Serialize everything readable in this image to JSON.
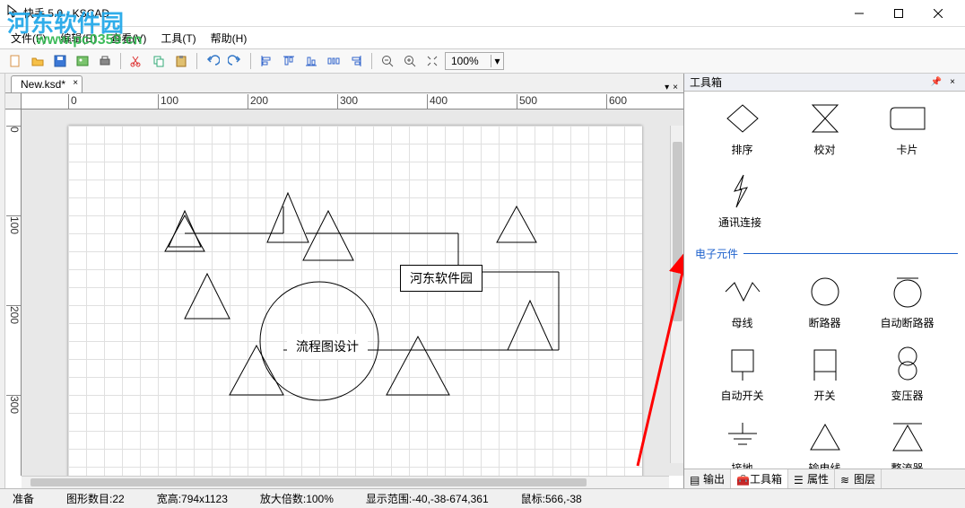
{
  "window": {
    "title": "快手 5.0 - KSCAD"
  },
  "menubar": {
    "file": "文件(F)",
    "edit": "编辑(E)",
    "view": "查看(V)",
    "tool": "工具(T)",
    "help": "帮助(H)"
  },
  "toolbar": {
    "zoom_value": "100%"
  },
  "tab": {
    "name": "New.ksd*"
  },
  "ruler_h": [
    "0",
    "100",
    "200",
    "300",
    "400",
    "500",
    "600"
  ],
  "ruler_v": [
    "0",
    "100",
    "200",
    "300"
  ],
  "canvas": {
    "label1": "河东软件园",
    "label2": "流程图设计"
  },
  "toolbox": {
    "title": "工具箱",
    "row1": {
      "a": "排序",
      "b": "校对",
      "c": "卡片"
    },
    "row2": {
      "a": "通讯连接",
      "b": "",
      "c": ""
    },
    "section": "电子元件",
    "row3": {
      "a": "母线",
      "b": "断路器",
      "c": "自动断路器"
    },
    "row4": {
      "a": "自动开关",
      "b": "开关",
      "c": "变压器"
    },
    "row5": {
      "a": "接地",
      "b": "输电线",
      "c": "整流器"
    },
    "tabs": {
      "output": "输出",
      "toolbox": "工具箱",
      "props": "属性",
      "layers": "图层"
    }
  },
  "status": {
    "ready": "准备",
    "shapes": "图形数目:22",
    "size": "宽高:794x1123",
    "zoom": "放大倍数:100%",
    "view": "显示范围:-40,-38-674,361",
    "mouse": "鼠标:566,-38"
  },
  "watermark": {
    "line1": "河东软件园",
    "line2": "www.pc0359.cn"
  }
}
